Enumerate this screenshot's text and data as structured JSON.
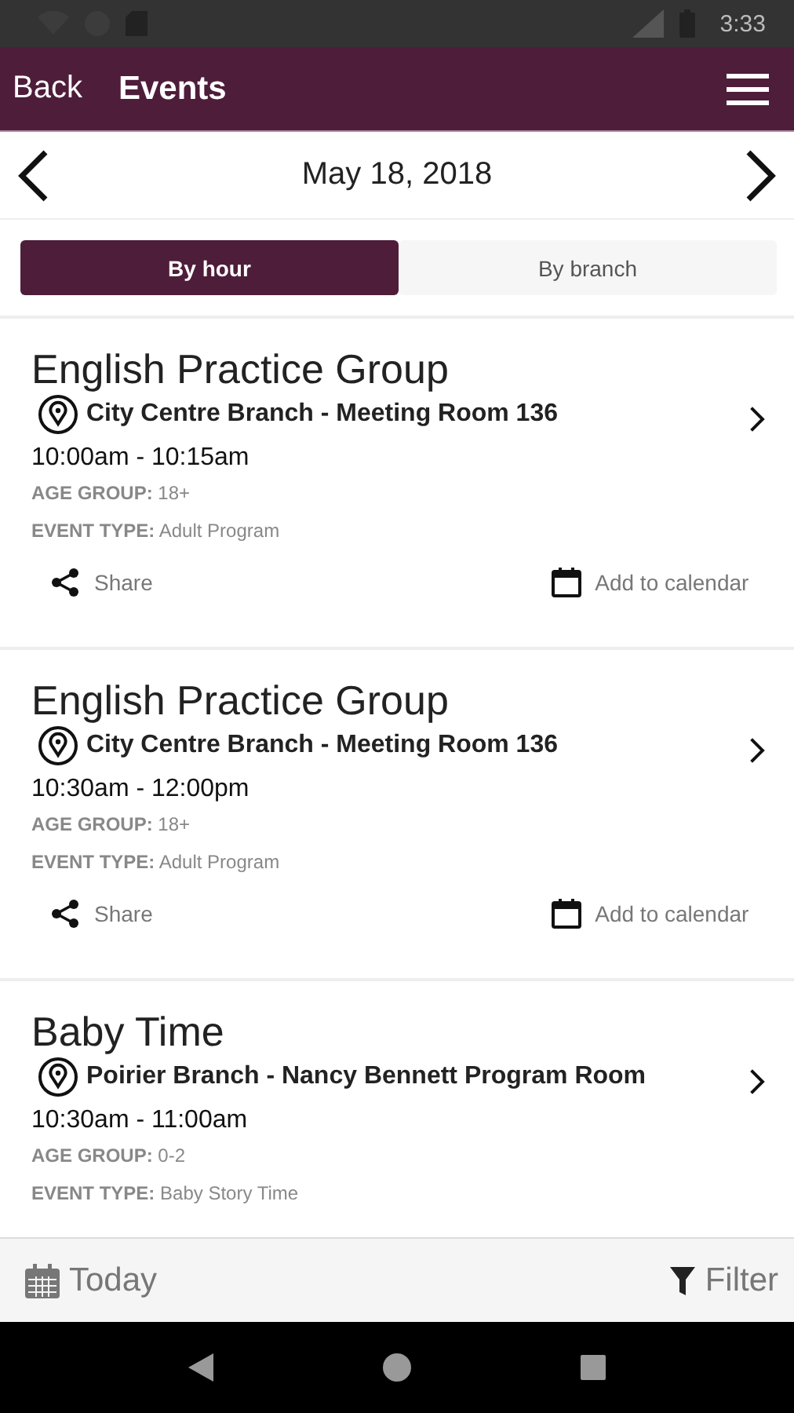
{
  "status_bar": {
    "time": "3:33"
  },
  "header": {
    "back": "Back",
    "title": "Events"
  },
  "date_nav": {
    "date": "May 18, 2018"
  },
  "tabs": [
    {
      "label": "By hour",
      "selected": true
    },
    {
      "label": "By branch",
      "selected": false
    }
  ],
  "events": [
    {
      "title": "English Practice Group",
      "location": "City Centre Branch - Meeting Room 136",
      "time": "10:00am - 10:15am",
      "age_group": "**AGE GROUP:** 18+",
      "event_type": "**EVENT TYPE:** Adult Program",
      "actions": {
        "share": "Share",
        "calendar": "Add to calendar"
      }
    },
    {
      "title": "English Practice Group",
      "location": "City Centre Branch - Meeting Room 136",
      "time": "10:30am - 12:00pm",
      "age_group": "**AGE GROUP:** 18+",
      "event_type": "**EVENT TYPE:** Adult Program",
      "actions": {
        "share": "Share",
        "calendar": "Add to calendar"
      }
    },
    {
      "title": "Baby Time",
      "location": "Poirier Branch - Nancy Bennett Program Room",
      "time": "10:30am - 11:00am",
      "age_group": "**AGE GROUP:** 0-2",
      "event_type": "**EVENT TYPE:** Baby Story Time"
    }
  ],
  "footer": {
    "today": "Today",
    "filter": "Filter"
  }
}
